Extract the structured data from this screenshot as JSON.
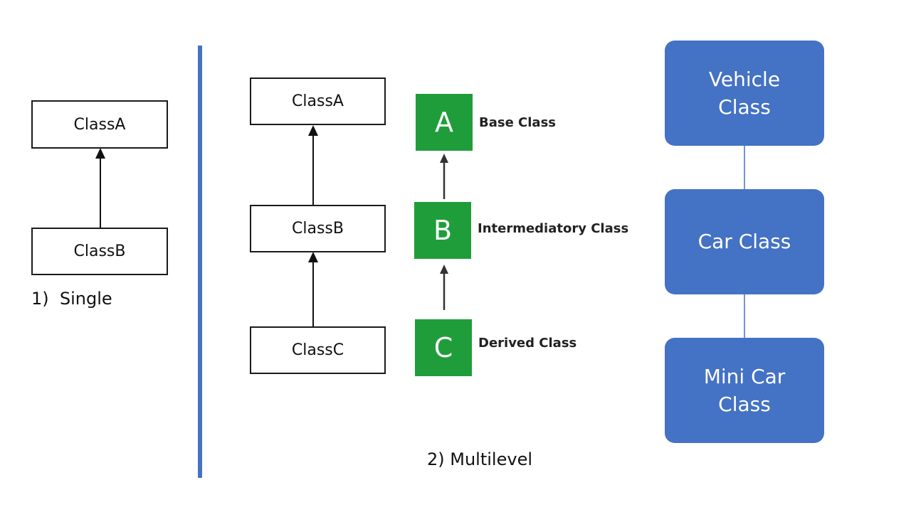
{
  "single": {
    "boxes": [
      "ClassA",
      "ClassB"
    ],
    "caption": "1)  Single"
  },
  "multilevel": {
    "boxes": [
      "ClassA",
      "ClassB",
      "ClassC"
    ],
    "legend": [
      {
        "letter": "A",
        "label": "Base Class"
      },
      {
        "letter": "B",
        "label": "Intermediatory Class"
      },
      {
        "letter": "C",
        "label": "Derived Class"
      }
    ],
    "caption": "2) Multilevel"
  },
  "vehicle_chain": {
    "boxes": [
      "Vehicle\nClass",
      "Car Class",
      "Mini Car\nClass"
    ]
  },
  "colors": {
    "divider": "#4472c4",
    "green": "#1f9d3a",
    "blue": "#4472c4"
  }
}
